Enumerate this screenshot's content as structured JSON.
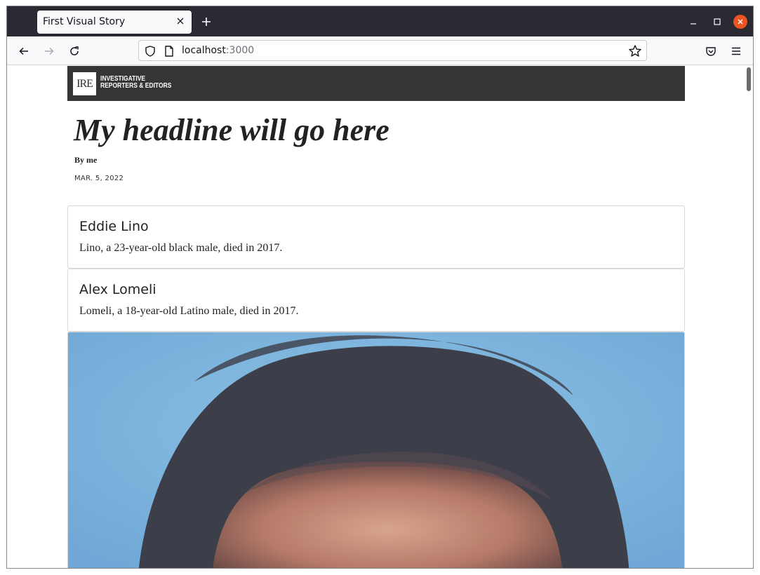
{
  "browser": {
    "tab_title": "First Visual Story",
    "url_host": "localhost",
    "url_port": ":3000"
  },
  "header": {
    "logo_letters": "IRE",
    "org_line1": "INVESTIGATIVE",
    "org_line2": "REPORTERS & EDITORS"
  },
  "article": {
    "headline": "My headline will go here",
    "byline": "By me",
    "date": "MAR. 5, 2022"
  },
  "cards": [
    {
      "name": "Eddie Lino",
      "description": "Lino, a 23-year-old black male, died in 2017."
    },
    {
      "name": "Alex Lomeli",
      "description": "Lomeli, a 18-year-old Latino male, died in 2017."
    }
  ],
  "colors": {
    "brand_bar": "#363434",
    "tabstrip": "#2b2a33",
    "close_button": "#e95420",
    "photo_background": "#7fb3dc"
  },
  "icons": [
    "close-icon",
    "plus-icon",
    "minimize-icon",
    "maximize-icon",
    "back-arrow-icon",
    "forward-arrow-icon",
    "reload-icon",
    "shield-icon",
    "page-icon",
    "star-icon",
    "pocket-icon",
    "hamburger-menu-icon"
  ]
}
